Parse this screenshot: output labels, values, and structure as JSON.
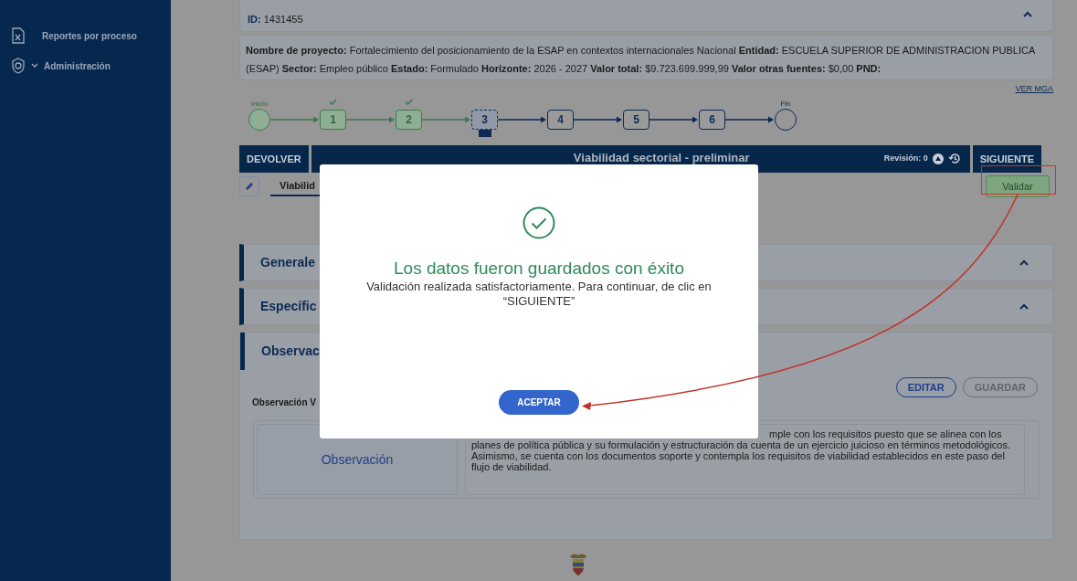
{
  "sidebar": {
    "items": [
      {
        "label": "Reportes por proceso",
        "kind": "report",
        "expandable": false
      },
      {
        "label": "Administración",
        "kind": "admin",
        "expandable": true
      }
    ]
  },
  "process_card": {
    "id_label": "ID:",
    "id_value": "1431455",
    "expanded": true
  },
  "project_card": {
    "text": "**Nombre de proyecto:** Fortalecimiento del posicionamiento de la ESAP en contextos internacionales Nacional **Entidad:** ESCUELA SUPERIOR DE ADMINISTRACION PUBLICA (ESAP) **Sector:** Empleo público **Estado:** Formulado **Horizonte:** 2026 - 2027 **Valor total:** $9.723.699.999,99 **Valor otras fuentes:** $0,00 **PND:**"
  },
  "ver_mga": "VER MGA",
  "stepper": {
    "start": "Inicio",
    "end": "Fin",
    "steps": [
      {
        "label": "1",
        "kind": "done"
      },
      {
        "label": "2",
        "kind": "done"
      },
      {
        "label": "3",
        "kind": "current"
      },
      {
        "label": "4",
        "kind": "pending"
      },
      {
        "label": "5",
        "kind": "pending"
      },
      {
        "label": "6",
        "kind": "pending"
      }
    ]
  },
  "action_bar": {
    "back": "DEVOLVER",
    "title": "Viabilidad sectorial - preliminar",
    "revision": "Revisión: 0",
    "next": "SIGUIENTE"
  },
  "tab": {
    "label": "Viabilid",
    "selected": true
  },
  "validate_button": "Validar",
  "sections": [
    {
      "title": "Generale",
      "expanded": true
    },
    {
      "title": "Específic",
      "expanded": true
    }
  ],
  "observations": {
    "title": "Observac",
    "edit": "EDITAR",
    "save": "GUARDAR",
    "save_disabled": true,
    "field_label": "Observación V",
    "cell_label": "Observación",
    "text": "mple con los requisitos puesto que se alinea con los planes de política pública y su formulación y estructuración da cuenta de un ejercicio juicioso en términos metodológicos. Asimismo, se cuenta con los documentos soporte y contempla los requisitos de viabilidad establecidos en este paso del flujo de viabilidad."
  },
  "modal": {
    "title": "Los datos fueron guardados con éxito",
    "message": "Validación realizada satisfactoriamente. Para continuar, de clic en “SIGUIENTE”",
    "button": "ACEPTAR"
  }
}
